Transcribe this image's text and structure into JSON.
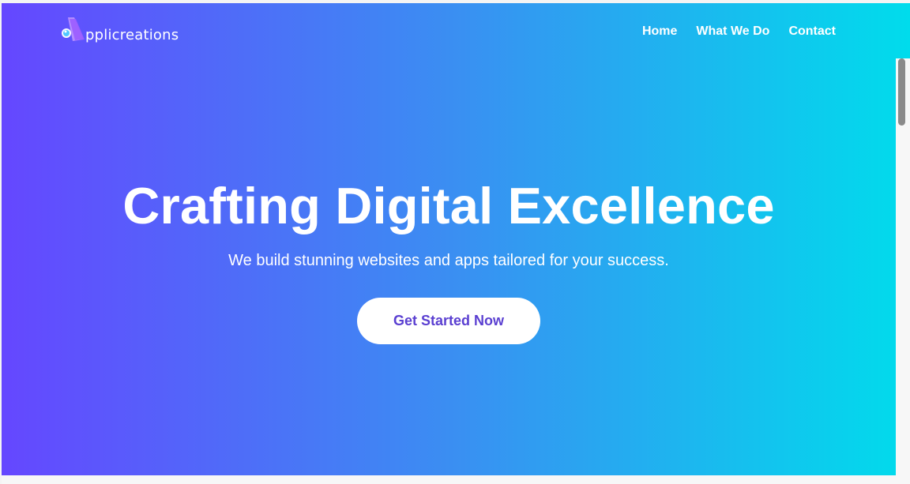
{
  "brand": {
    "name": "pplicreations",
    "logo_icon": "app-logo-icon"
  },
  "navbar": {
    "items": [
      {
        "label": "Home"
      },
      {
        "label": "What We Do"
      },
      {
        "label": "Contact"
      }
    ]
  },
  "hero": {
    "headline": "Crafting Digital Excellence",
    "subtitle": "We build stunning websites and apps tailored for your success.",
    "cta_label": "Get Started Now"
  },
  "colors": {
    "gradient_start": "#6547ff",
    "gradient_mid": "#3a8ff2",
    "gradient_end": "#00dcec",
    "cta_text": "#5a3fd1",
    "cta_background": "#ffffff",
    "text_light": "#ffffff"
  }
}
